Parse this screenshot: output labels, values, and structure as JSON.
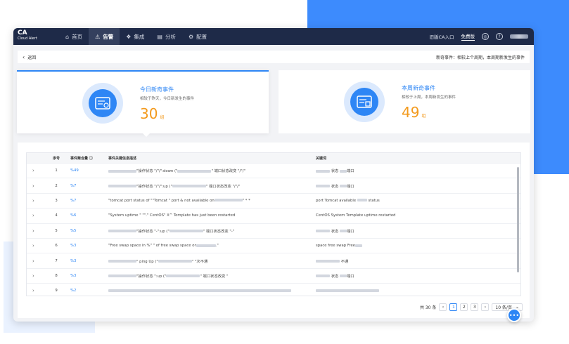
{
  "app": {
    "logo_main": "CA",
    "logo_sub": "Cloud Alert"
  },
  "nav": [
    {
      "label": "首页",
      "icon": "home-icon",
      "glyph": "⌂"
    },
    {
      "label": "告警",
      "icon": "alarm-icon",
      "glyph": "⚠"
    },
    {
      "label": "集成",
      "icon": "layers-icon",
      "glyph": "❖"
    },
    {
      "label": "分析",
      "icon": "chart-icon",
      "glyph": "▤"
    },
    {
      "label": "配置",
      "icon": "gear-icon",
      "glyph": "⚙"
    }
  ],
  "topright": {
    "old_entry": "旧版CA入口",
    "trial": "免费版",
    "bell_glyph": "◎",
    "help_glyph": "?"
  },
  "subbar": {
    "back_label": "返回",
    "info": "新奇事件：相较上个周期，本周期新发生的事件"
  },
  "cards": {
    "today": {
      "title": "今日新奇事件",
      "desc": "相较于昨天，今日新发生的事件",
      "value": "30",
      "unit": "组"
    },
    "week": {
      "title": "本周新奇事件",
      "desc": "相较于上周，本周新发生的事件",
      "value": "49",
      "unit": "组"
    }
  },
  "table": {
    "headers": {
      "idx": "序号",
      "count": "事件聚合量",
      "count_info_glyph": "ⓘ",
      "desc": "事件关键信息描述",
      "key": "关键词"
    },
    "rows": [
      {
        "idx": "1",
        "count": "%49",
        "desc": "\"操作状态 \"/\"/\":down (\"",
        "desc2": "\" 端口状态改变 \"/\"/\"",
        "key": "状态",
        "key2": "端口"
      },
      {
        "idx": "2",
        "count": "%7",
        "desc": "\"操作状态 \"/\"/\":up (\"",
        "desc2": "\" 端口状态改变 \"/\"/\"",
        "key": "状态",
        "key2": "端口"
      },
      {
        "idx": "3",
        "count": "%7",
        "desc": "\"tomcat port status of \"\"Tomcat \" port & not available on",
        "desc2": "\" * *",
        "key": "port Tomcat available",
        "key2": "status"
      },
      {
        "idx": "4",
        "count": "%6",
        "desc": "\"System uptime \" \"\".\" CentOS\" X^ Template has just been restarted",
        "desc2": "",
        "key": "CentOS System Template uptime restarted",
        "key2": ""
      },
      {
        "idx": "5",
        "count": "%5",
        "desc": "\"操作状态 \"-\":up (\"",
        "desc2": "\" 端口状态改变 \"-\"",
        "key": "状态",
        "key2": "端口"
      },
      {
        "idx": "6",
        "count": "%3",
        "desc": "\"Free swap space in %\" \" of free swap space or",
        "desc2": ".\"",
        "key": "space free swap Free",
        "key2": ""
      },
      {
        "idx": "7",
        "count": "%3",
        "desc": "\" ping Up (\"",
        "desc2": "\" \"次不通",
        "key": "",
        "key2": "不通"
      },
      {
        "idx": "8",
        "count": "%3",
        "desc": "\"操作状态 \":up (\"",
        "desc2": "\" 端口状态改变 \"",
        "key": "状态",
        "key2": "端口"
      },
      {
        "idx": "9",
        "count": "%2",
        "desc": "",
        "desc2": "",
        "key": "",
        "key2": ""
      }
    ]
  },
  "pager": {
    "total": "共 30 条",
    "prev_glyph": "‹",
    "next_glyph": "›",
    "pages": [
      "1",
      "2",
      "3"
    ],
    "current": "1",
    "size": "10 条/页",
    "size_glyph": "⌄"
  },
  "chat_glyph": "•••",
  "colors": {
    "accent": "#2e86f5",
    "number": "#f39a1d",
    "topbar": "#1e2a48"
  }
}
